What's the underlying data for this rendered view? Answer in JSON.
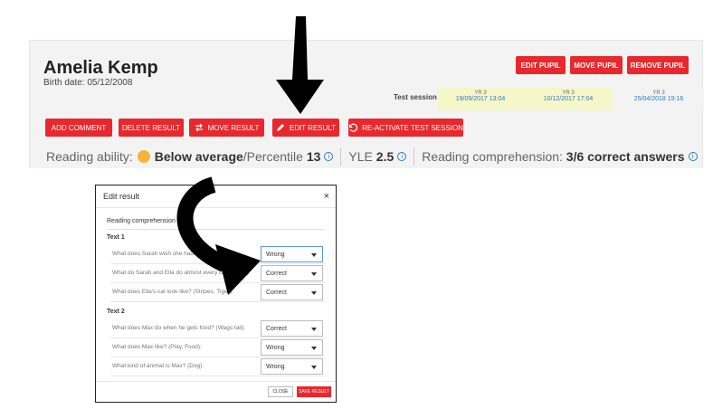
{
  "pupil": {
    "name": "Amelia Kemp",
    "birth": "Birth date: 05/12/2008"
  },
  "top_buttons": {
    "edit": "EDIT PUPIL",
    "move": "MOVE PUPIL",
    "remove": "REMOVE PUPIL"
  },
  "sessions": {
    "label": "Test session",
    "items": [
      {
        "year": "YR 3",
        "date": "19/09/2017 13:04"
      },
      {
        "year": "YR 3",
        "date": "10/12/2017 17:04"
      },
      {
        "year": "YR 3",
        "date": "25/04/2018 19:16"
      }
    ]
  },
  "actions": {
    "add_comment": "ADD COMMENT",
    "delete_result": "DELETE RESULT",
    "move_result": "MOVE RESULT",
    "edit_result": "EDIT RESULT",
    "reactivate": "RE-ACTIVATE TEST SESSION"
  },
  "summary": {
    "reading_label": "Reading ability:",
    "reading_value": "Below average",
    "percentile_label": "/Percentile",
    "percentile_value": "13",
    "yle_label": "YLE",
    "yle_value": "2.5",
    "comprehension_label": "Reading comprehension:",
    "comprehension_value": "3/6 correct answers"
  },
  "modal": {
    "title": "Edit result",
    "close_icon": "×",
    "section": "Reading comprehension",
    "text1": "Text 1",
    "text2": "Text 2",
    "questions": [
      {
        "q": "What does Sarah wish she had? (Ha...",
        "value": "Wrong"
      },
      {
        "q": "What do Sarah and Ella do almost every day? (Play):",
        "value": "Correct"
      },
      {
        "q": "What does Ella's cat look like? (Stripes, Tiger):",
        "value": "Correct"
      },
      {
        "q": "What does Max do when he gets food? (Wags tail):",
        "value": "Correct"
      },
      {
        "q": "What does Max like? (Play, Food):",
        "value": "Wrong"
      },
      {
        "q": "What kind of animal is Max? (Dog):",
        "value": "Wrong"
      }
    ],
    "close_btn": "CLOSE",
    "save_btn": "SAVE RESULT"
  },
  "colors": {
    "accent": "#e8282c",
    "session_active": "#f6f7c9",
    "link": "#2a7bbf"
  },
  "icons": [
    "move-arrows-icon",
    "pencil-icon",
    "undo-icon",
    "info-icon",
    "close-icon",
    "chevron-down-icon",
    "down-arrow-icon",
    "curved-arrow-icon"
  ]
}
